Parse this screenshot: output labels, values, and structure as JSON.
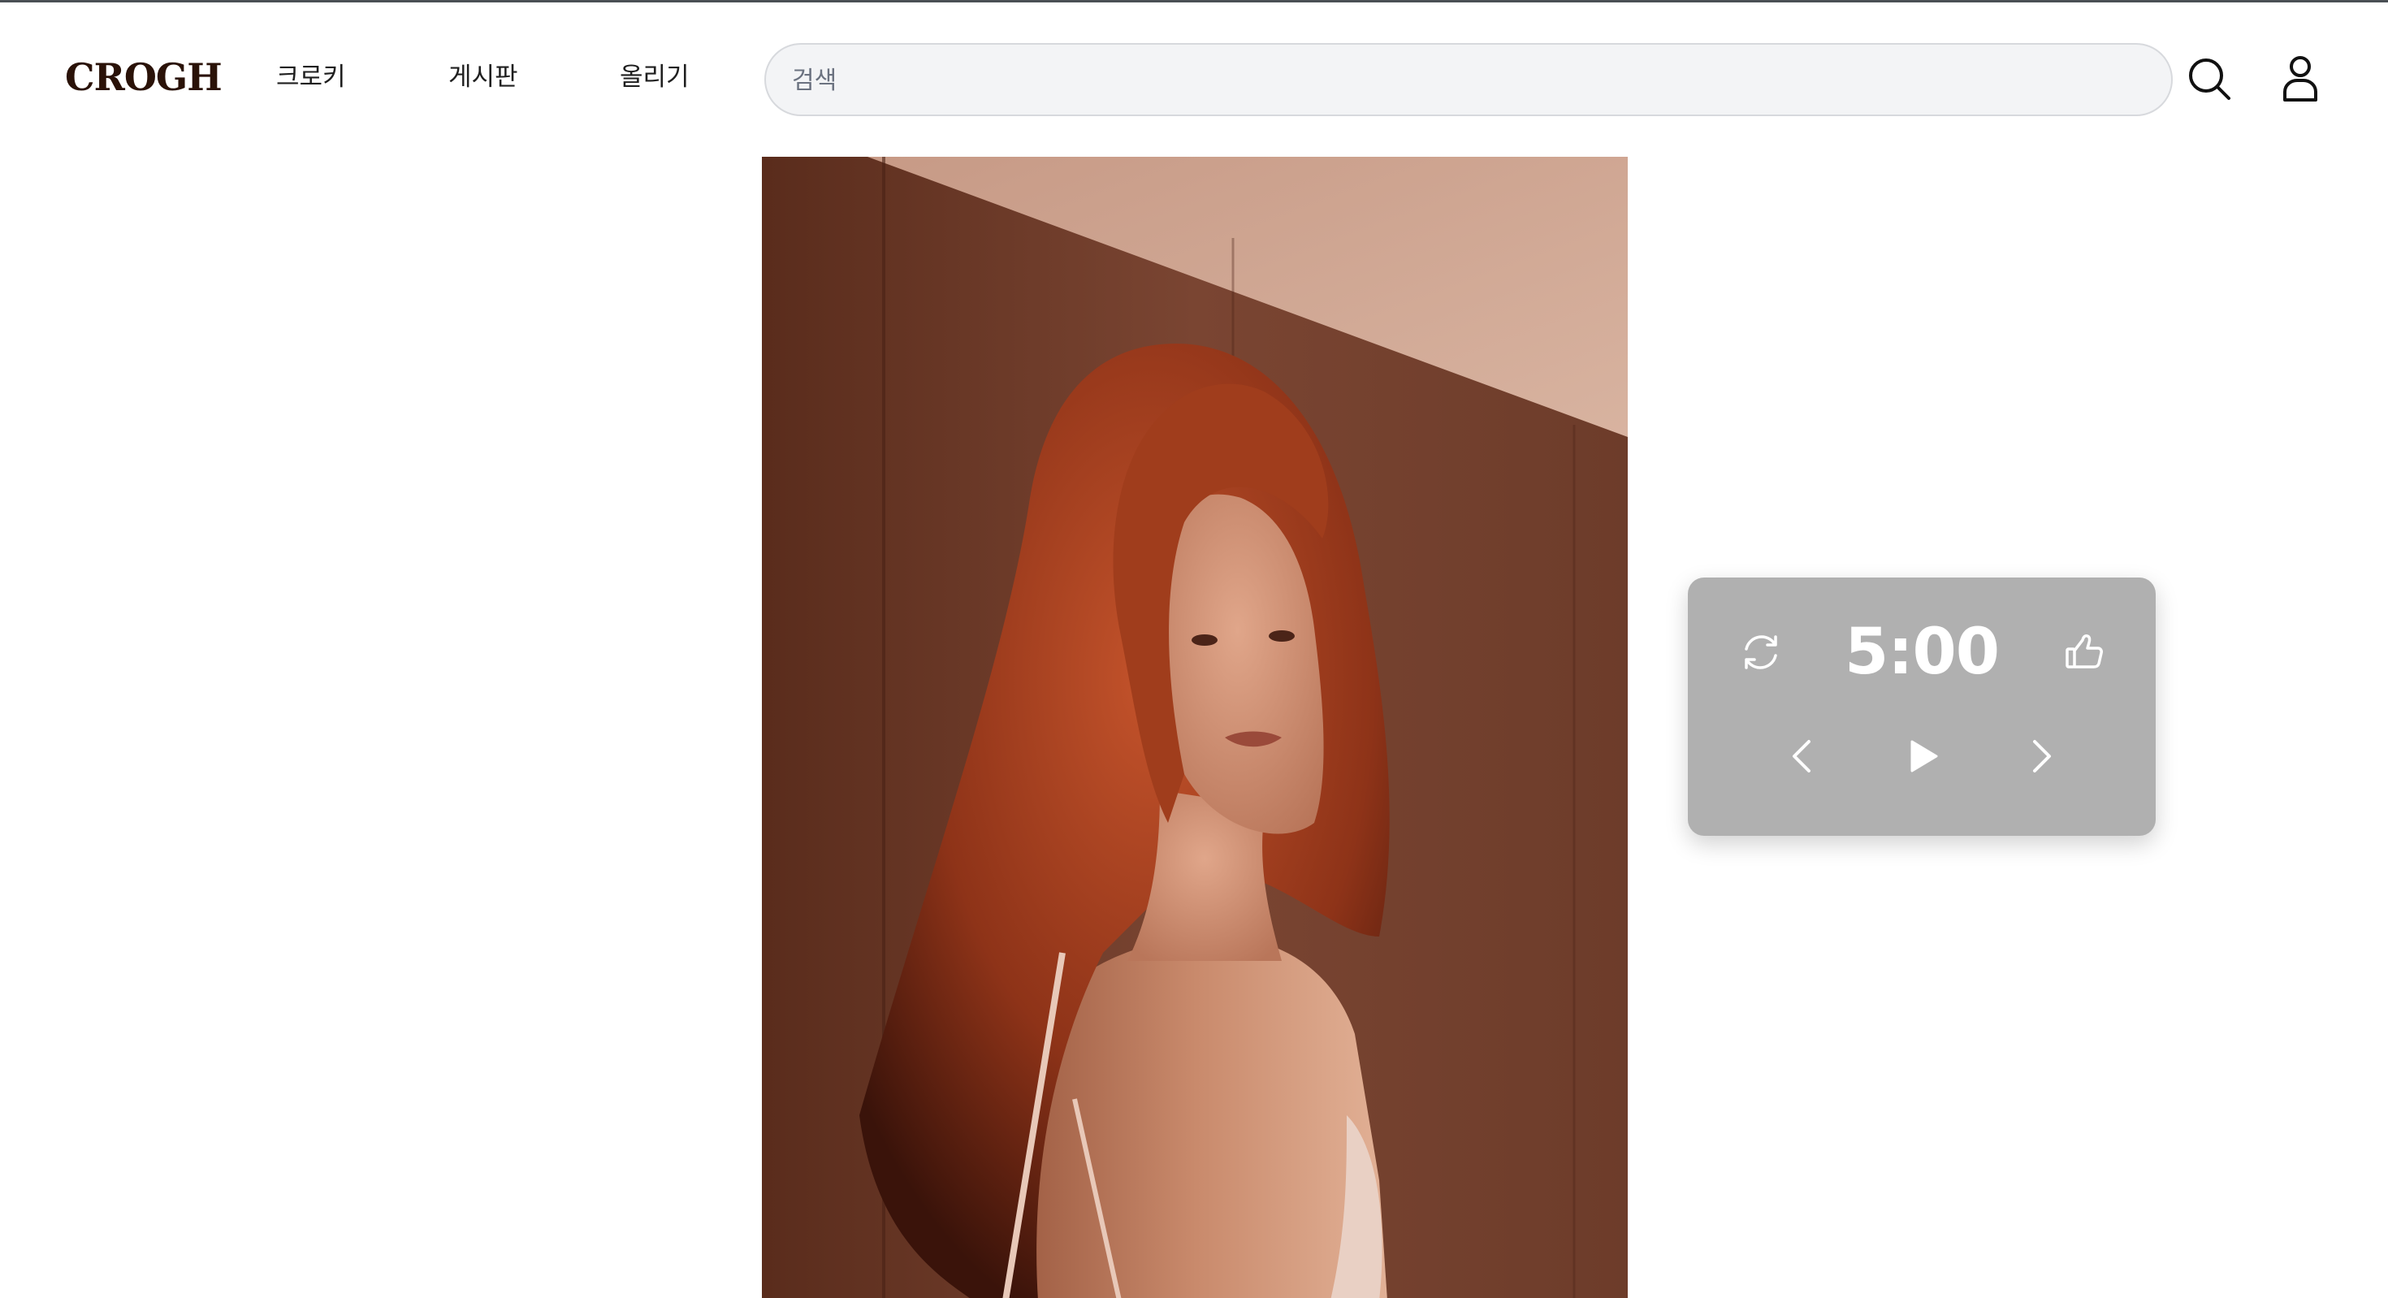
{
  "header": {
    "logo": "CROGH",
    "nav": [
      {
        "label": "크로키"
      },
      {
        "label": "게시판"
      },
      {
        "label": "올리기"
      }
    ],
    "search": {
      "placeholder": "검색",
      "value": ""
    },
    "icons": {
      "search": "search-icon",
      "user": "user-icon"
    }
  },
  "main": {
    "photo": {
      "subject": "portrait photo"
    }
  },
  "timer": {
    "time": "5:00",
    "icons": {
      "refresh": "refresh-icon",
      "like": "thumbs-up-icon",
      "prev": "chevron-left-icon",
      "play": "play-icon",
      "next": "chevron-right-icon"
    },
    "panel_color": "#b0b0b0"
  }
}
